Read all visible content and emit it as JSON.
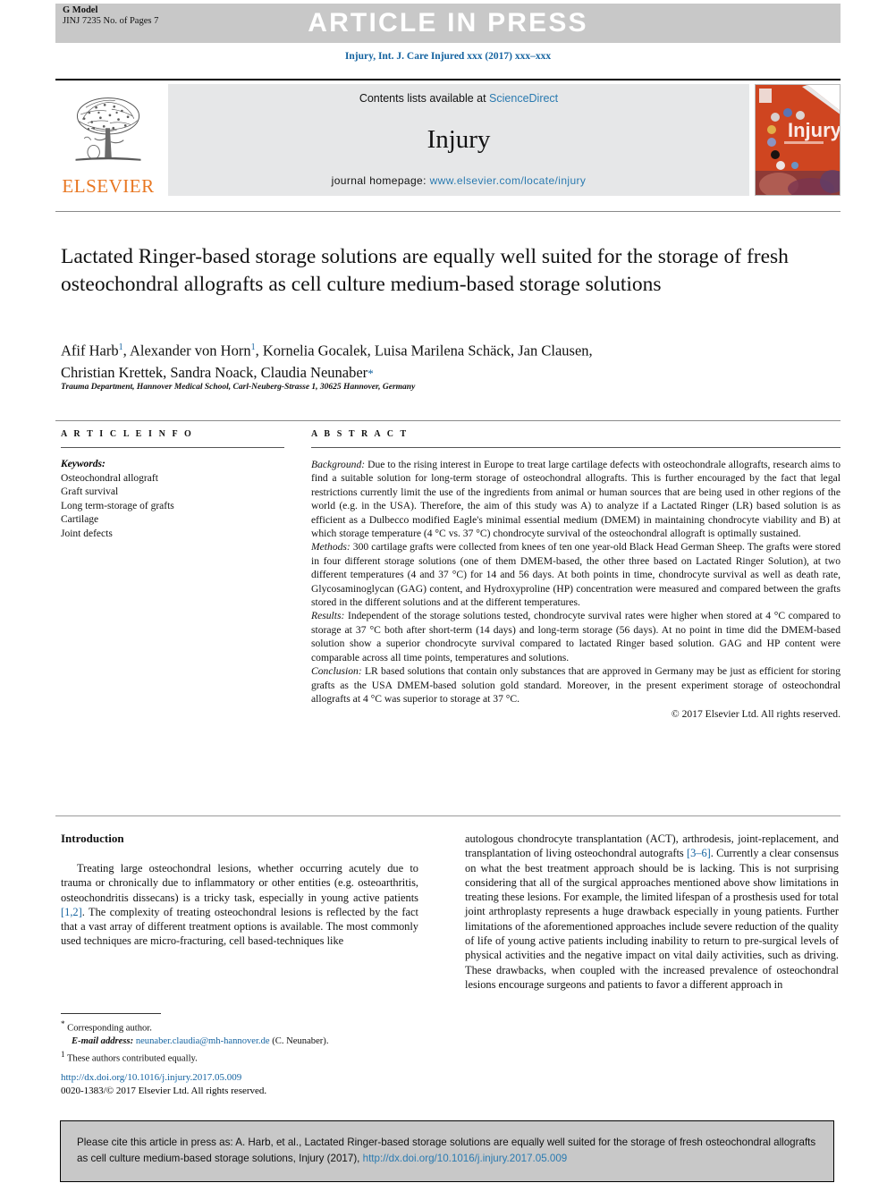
{
  "header": {
    "g_model": "G Model",
    "g_model_sub": "JINJ 7235 No. of Pages 7",
    "banner_text": "ARTICLE IN PRESS",
    "journal_ref": "Injury, Int. J. Care Injured xxx (2017) xxx–xxx"
  },
  "masthead": {
    "contents_prefix": "Contents lists available at ",
    "sciencedirect": "ScienceDirect",
    "journal_name": "Injury",
    "homepage_label": "journal homepage: ",
    "homepage_url": "www.elsevier.com/locate/injury",
    "publisher": "ELSEVIER",
    "cover_title": "Injury",
    "cover_color": "#cf4520",
    "link_color": "#2a7ab0"
  },
  "article": {
    "title": "Lactated Ringer-based storage solutions are equally well suited for the storage of fresh osteochondral allografts as cell culture medium-based storage solutions",
    "authors_line1_a": "Afif Harb",
    "authors_sup1": "1",
    "authors_line1_b": ", Alexander von Horn",
    "authors_sup2": "1",
    "authors_line1_c": ", Kornelia Gocalek, Luisa Marilena Schäck, Jan Clausen,",
    "authors_line2": "Christian Krettek, Sandra Noack, Claudia Neunaber",
    "affiliation": "Trauma Department, Hannover Medical School, Carl-Neuberg-Strasse 1, 30625 Hannover, Germany"
  },
  "article_info": {
    "heading": "A R T I C L E   I N F O",
    "keywords_label": "Keywords:",
    "keywords": [
      "Osteochondral allograft",
      "Graft survival",
      "Long term-storage of grafts",
      "Cartilage",
      "Joint defects"
    ]
  },
  "abstract": {
    "heading": "A B S T R A C T",
    "background_label": "Background:",
    "background": " Due to the rising interest in Europe to treat large cartilage defects with osteochondrale allografts, research aims to find a suitable solution for long-term storage of osteochondral allografts. This is further encouraged by the fact that legal restrictions currently limit the use of the ingredients from animal or human sources that are being used in other regions of the world (e.g. in the USA). Therefore, the aim of this study was A) to analyze if a Lactated Ringer (LR) based solution is as efficient as a Dulbecco modified Eagle's minimal essential medium (DMEM) in maintaining chondrocyte viability and B) at which storage temperature (4 °C vs. 37 °C) chondrocyte survival of the osteochondral allograft is optimally sustained.",
    "methods_label": "Methods:",
    "methods": " 300 cartilage grafts were collected from knees of ten one year-old Black Head German Sheep. The grafts were stored in four different storage solutions (one of them DMEM-based, the other three based on Lactated Ringer Solution), at two different temperatures (4 and 37 °C) for 14 and 56 days. At both points in time, chondrocyte survival as well as death rate, Glycosaminoglycan (GAG) content, and Hydroxyproline (HP) concentration were measured and compared between the grafts stored in the different solutions and at the different temperatures.",
    "results_label": "Results:",
    "results": " Independent of the storage solutions tested, chondrocyte survival rates were higher when stored at 4 °C compared to storage at 37 °C both after short-term (14 days) and long-term storage (56 days). At no point in time did the DMEM-based solution show a superior chondrocyte survival compared to lactated Ringer based solution. GAG and HP content were comparable across all time points, temperatures and solutions.",
    "conclusion_label": "Conclusion:",
    "conclusion": " LR based solutions that contain only substances that are approved in Germany may be just as efficient for storing grafts as the USA DMEM-based solution gold standard. Moreover, in the present experiment storage of osteochondral allografts at 4 °C was superior to storage at 37 °C.",
    "copyright": "© 2017 Elsevier Ltd. All rights reserved."
  },
  "introduction": {
    "heading": "Introduction",
    "left_p1_a": "Treating large osteochondral lesions, whether occurring acutely due to trauma or chronically due to inflammatory or other entities (e.g. osteoarthritis, osteochondritis dissecans) is a tricky task, especially in young active patients ",
    "left_ref1": "[1,2]",
    "left_p1_b": ". The complexity of treating osteochondral lesions is reflected by the fact that a vast array of different treatment options is available. The most commonly used techniques are micro-fracturing, cell based-techniques like",
    "right_p1_a": "autologous chondrocyte transplantation (ACT), arthrodesis, joint-replacement, and transplantation of living osteochondral autografts ",
    "right_ref1": "[3–6]",
    "right_p1_b": ". Currently a clear consensus on what the best treatment approach should be is lacking. This is not surprising considering that all of the surgical approaches mentioned above show limitations in treating these lesions. For example, the limited lifespan of a prosthesis used for total joint arthroplasty represents a huge drawback especially in young patients. Further limitations of the aforementioned approaches include severe reduction of the quality of life of young active patients including inability to return to pre-surgical levels of physical activities and the negative impact on vital daily activities, such as driving. These drawbacks, when coupled with the increased prevalence of osteochondral lesions encourage surgeons and patients to favor a different approach in"
  },
  "footnotes": {
    "star_mark": "*",
    "corresponding": " Corresponding author.",
    "email_label": "E-mail address:",
    "email": "neunaber.claudia@mh-hannover.de",
    "email_suffix": " (C. Neunaber).",
    "num_mark": "1",
    "equal_contrib": " These authors contributed equally."
  },
  "doi_block": {
    "doi_url": "http://dx.doi.org/10.1016/j.injury.2017.05.009",
    "issn_line": "0020-1383/© 2017 Elsevier Ltd. All rights reserved."
  },
  "cite_box": {
    "text_a": "Please cite this article in press as: A. Harb, et al., Lactated Ringer-based storage solutions are equally well suited for the storage of fresh osteochondral allografts as cell culture medium-based storage solutions, Injury (2017), ",
    "doi": "http://dx.doi.org/10.1016/j.injury.2017.05.009"
  }
}
